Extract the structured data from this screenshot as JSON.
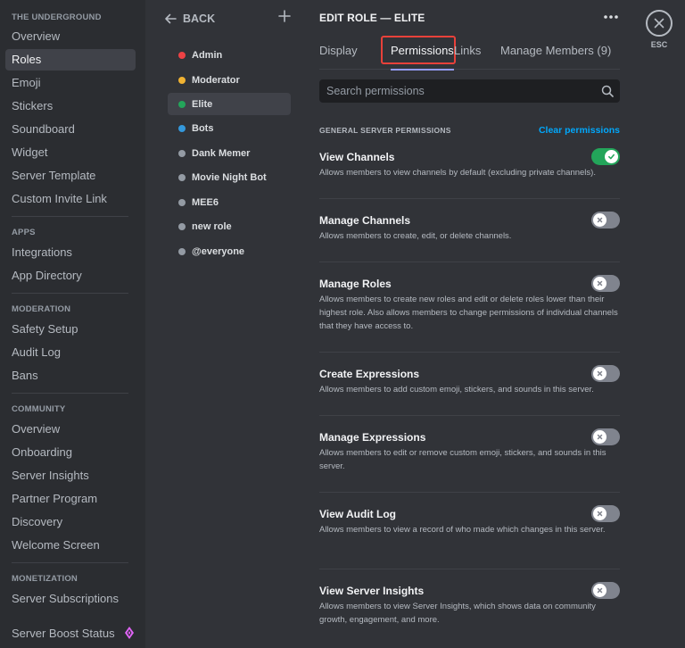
{
  "sidebar": {
    "server_header": "THE UNDERGROUND",
    "server_items": [
      {
        "label": "Overview"
      },
      {
        "label": "Roles",
        "active": true
      },
      {
        "label": "Emoji"
      },
      {
        "label": "Stickers"
      },
      {
        "label": "Soundboard"
      },
      {
        "label": "Widget"
      },
      {
        "label": "Server Template"
      },
      {
        "label": "Custom Invite Link"
      }
    ],
    "apps_header": "APPS",
    "apps_items": [
      {
        "label": "Integrations"
      },
      {
        "label": "App Directory"
      }
    ],
    "moderation_header": "MODERATION",
    "moderation_items": [
      {
        "label": "Safety Setup"
      },
      {
        "label": "Audit Log"
      },
      {
        "label": "Bans"
      }
    ],
    "community_header": "COMMUNITY",
    "community_items": [
      {
        "label": "Overview"
      },
      {
        "label": "Onboarding"
      },
      {
        "label": "Server Insights"
      },
      {
        "label": "Partner Program"
      },
      {
        "label": "Discovery"
      },
      {
        "label": "Welcome Screen"
      }
    ],
    "monetization_header": "MONETIZATION",
    "monetization_items": [
      {
        "label": "Server Subscriptions"
      },
      {
        "label": "Server Boost Status"
      }
    ],
    "boost_icon": "boost-gem-icon"
  },
  "roles_panel": {
    "back_label": "BACK",
    "back_icon": "arrow-left-icon",
    "add_icon": "plus-icon",
    "roles": [
      {
        "name": "Admin",
        "color": "#ed4245"
      },
      {
        "name": "Moderator",
        "color": "#f0b232"
      },
      {
        "name": "Elite",
        "color": "#23a55a",
        "active": true
      },
      {
        "name": "Bots",
        "color": "#3498db"
      },
      {
        "name": "Dank Memer",
        "color": "#949ba4"
      },
      {
        "name": "Movie Night Bot",
        "color": "#949ba4"
      },
      {
        "name": "MEE6",
        "color": "#949ba4"
      },
      {
        "name": "new role",
        "color": "#949ba4"
      },
      {
        "name": "@everyone",
        "color": "#949ba4"
      }
    ]
  },
  "main": {
    "title": "EDIT ROLE — ELITE",
    "more_icon": "more-dots-icon",
    "tabs": [
      {
        "label": "Display"
      },
      {
        "label": "Permissions",
        "active": true
      },
      {
        "label": "Links"
      },
      {
        "label": "Manage Members (9)"
      }
    ],
    "search_placeholder": "Search permissions",
    "search_icon": "search-icon",
    "section_title": "GENERAL SERVER PERMISSIONS",
    "clear_label": "Clear permissions",
    "permissions": [
      {
        "name": "View Channels",
        "desc": "Allows members to view channels by default (excluding private channels).",
        "enabled": true
      },
      {
        "name": "Manage Channels",
        "desc": "Allows members to create, edit, or delete channels.",
        "enabled": false
      },
      {
        "name": "Manage Roles",
        "desc": "Allows members to create new roles and edit or delete roles lower than their highest role. Also allows members to change permissions of individual channels that they have access to.",
        "enabled": false
      },
      {
        "name": "Create Expressions",
        "desc": "Allows members to add custom emoji, stickers, and sounds in this server.",
        "enabled": false
      },
      {
        "name": "Manage Expressions",
        "desc": "Allows members to edit or remove custom emoji, stickers, and sounds in this server.",
        "enabled": false
      },
      {
        "name": "View Audit Log",
        "desc": "Allows members to view a record of who made which changes in this server.",
        "enabled": false
      },
      {
        "name": "View Server Insights",
        "desc": "Allows members to view Server Insights, which shows data on community growth, engagement, and more.",
        "enabled": false
      }
    ]
  },
  "close": {
    "icon": "close-icon",
    "esc_label": "ESC"
  },
  "colors": {
    "accent_highlight": "#e8413a",
    "toggle_on": "#23a55a",
    "toggle_off": "#80848e",
    "link": "#00a8fc",
    "boost": "#e164f7"
  }
}
